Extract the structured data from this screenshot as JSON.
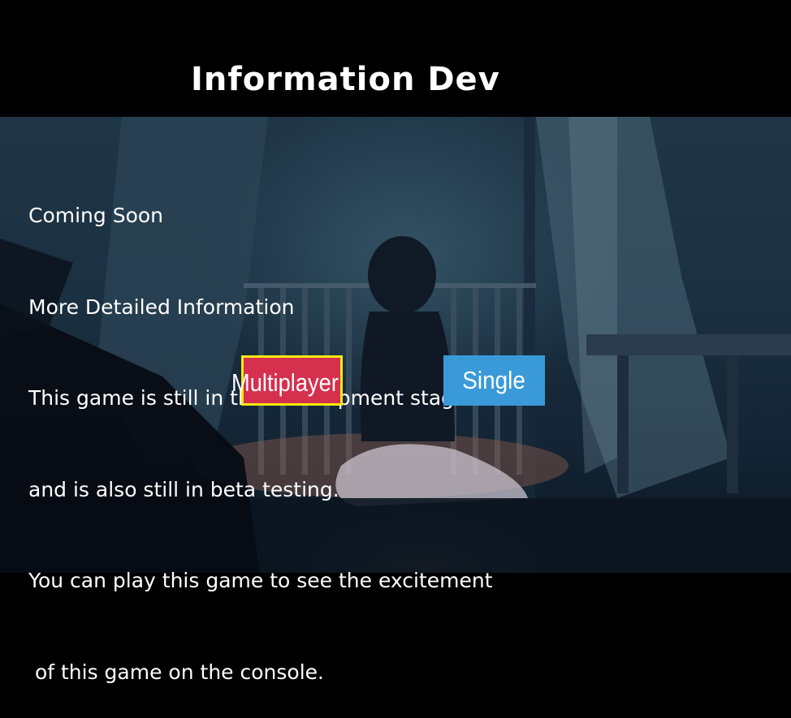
{
  "header": {
    "title": "Information Dev"
  },
  "info": {
    "lines": [
      "Coming Soon",
      "More Detailed Information",
      "This game is still in the development stage",
      "and is also still in beta testing.",
      "You can play this game to see the excitement",
      " of this game on the console."
    ]
  },
  "buttons": {
    "multiplayer_label": "Multiplayer",
    "single_label": "Single"
  },
  "colors": {
    "background": "#000000",
    "text": "#ffffff",
    "multiplayer_selected_fill": "#d6304f",
    "selection_outline": "#f5e90f",
    "single_button": "#3a9ad9"
  },
  "state": {
    "selected_button": "multiplayer"
  }
}
